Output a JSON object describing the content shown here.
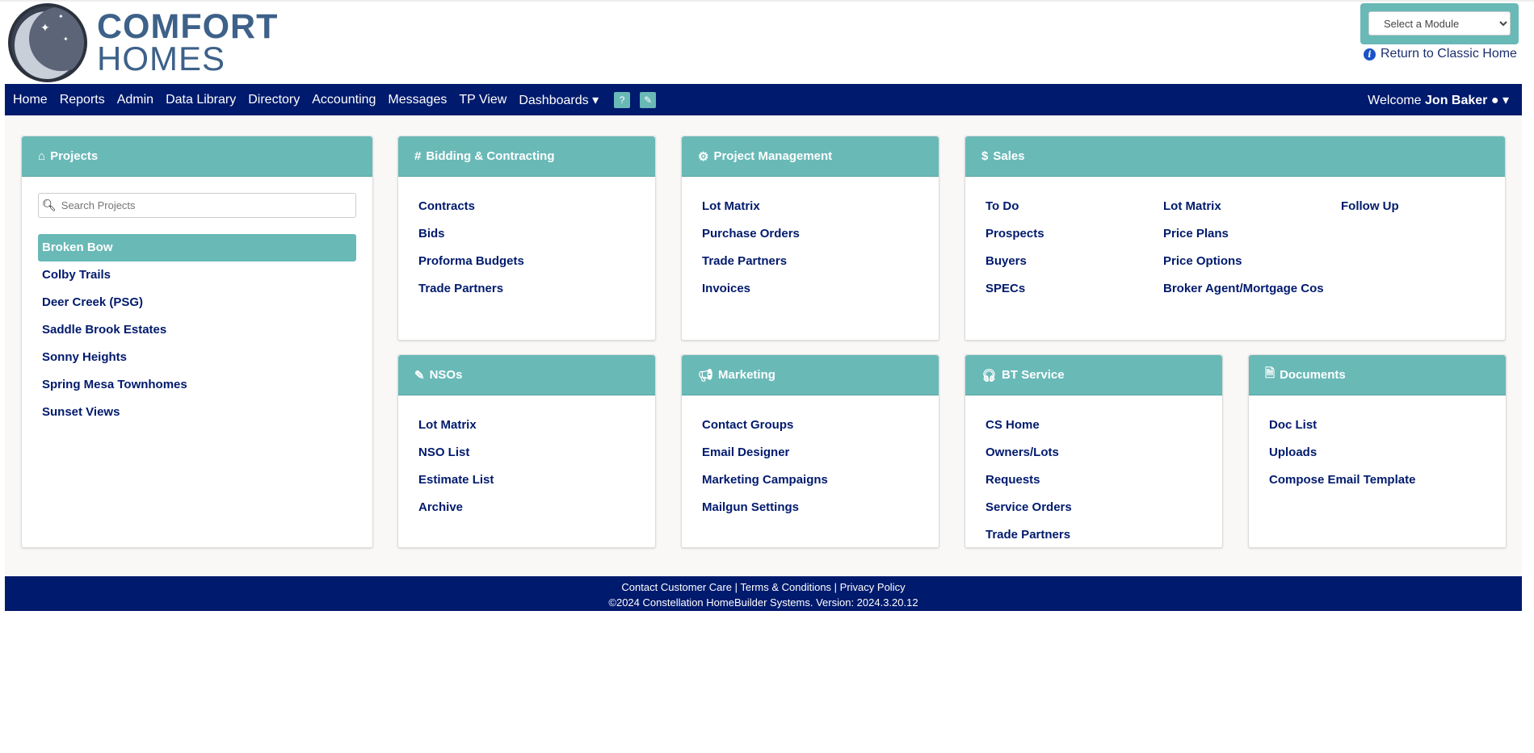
{
  "logo": {
    "line1": "COMFORT",
    "line2": "HOMES"
  },
  "module_select": {
    "value": "Select a Module"
  },
  "classic_link": "Return to Classic Home",
  "nav": {
    "items": [
      "Home",
      "Reports",
      "Admin",
      "Data Library",
      "Directory",
      "Accounting",
      "Messages",
      "TP View",
      "Dashboards ▾"
    ],
    "welcome": "Welcome",
    "user": "Jon Baker"
  },
  "projects": {
    "title": "Projects",
    "search_placeholder": "Search Projects",
    "items": [
      "Broken Bow",
      "Colby Trails",
      "Deer Creek (PSG)",
      "Saddle Brook Estates",
      "Sonny Heights",
      "Spring Mesa Townhomes",
      "Sunset Views"
    ],
    "selected": "Broken Bow"
  },
  "bidding": {
    "title": "Bidding & Contracting",
    "links": [
      "Contracts",
      "Bids",
      "Proforma Budgets",
      "Trade Partners"
    ]
  },
  "pm": {
    "title": "Project Management",
    "links": [
      "Lot Matrix",
      "Purchase Orders",
      "Trade Partners",
      "Invoices"
    ]
  },
  "sales": {
    "title": "Sales",
    "col1": [
      "To Do",
      "Prospects",
      "Buyers",
      "SPECs"
    ],
    "col2": [
      "Lot Matrix",
      "Price Plans",
      "Price Options",
      "Broker Agent/Mortgage Cos"
    ],
    "col3": [
      "Follow Up"
    ]
  },
  "nsos": {
    "title": "NSOs",
    "links": [
      "Lot Matrix",
      "NSO List",
      "Estimate List",
      "Archive"
    ]
  },
  "marketing": {
    "title": "Marketing",
    "links": [
      "Contact Groups",
      "Email Designer",
      "Marketing Campaigns",
      "Mailgun Settings"
    ]
  },
  "bt": {
    "title": "BT Service",
    "links": [
      "CS Home",
      "Owners/Lots",
      "Requests",
      "Service Orders",
      "Trade Partners"
    ]
  },
  "documents": {
    "title": "Documents",
    "links": [
      "Doc List",
      "Uploads",
      "Compose Email Template"
    ]
  },
  "footer": {
    "contact": "Contact Customer Care",
    "terms": "Terms & Conditions",
    "privacy": "Privacy Policy",
    "copyright": "©2024 Constellation HomeBuilder Systems. Version: 2024.3.20.12"
  },
  "colors": {
    "navy": "#001a6d",
    "teal": "#69b9b7"
  }
}
